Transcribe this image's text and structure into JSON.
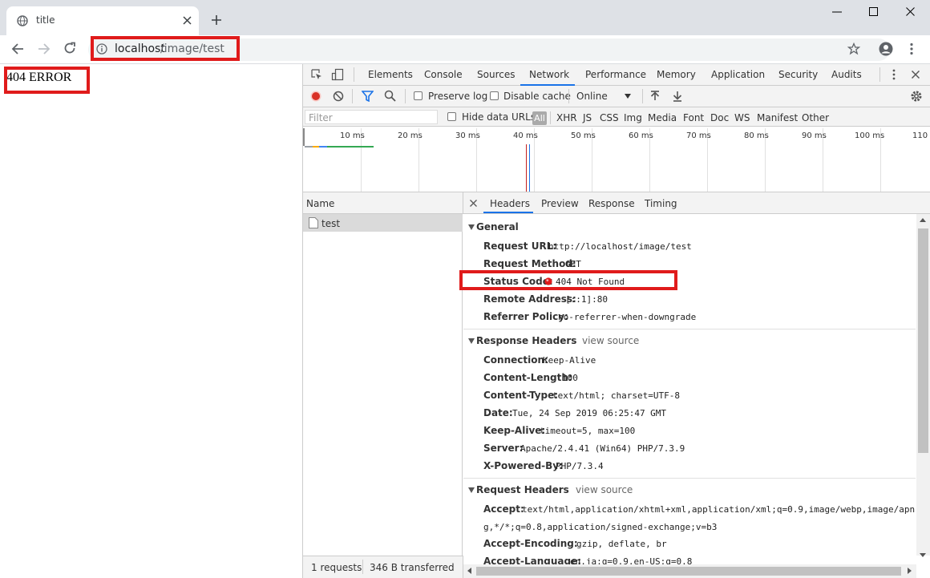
{
  "browser": {
    "tab_title": "title",
    "url_host": "localhost",
    "url_path": "/image/test"
  },
  "page": {
    "text": "404 ERROR"
  },
  "devtools": {
    "tabs": [
      "Elements",
      "Console",
      "Sources",
      "Network",
      "Performance",
      "Memory",
      "Application",
      "Security",
      "Audits"
    ],
    "active_tab": "Network",
    "toolbar": {
      "preserve_log": "Preserve log",
      "disable_cache": "Disable cache",
      "throttle": "Online"
    },
    "filter": {
      "placeholder": "Filter",
      "hide_data_urls": "Hide data URLs",
      "types": [
        "All",
        "XHR",
        "JS",
        "CSS",
        "Img",
        "Media",
        "Font",
        "Doc",
        "WS",
        "Manifest",
        "Other"
      ]
    },
    "timeline_ticks": [
      "10 ms",
      "20 ms",
      "30 ms",
      "40 ms",
      "50 ms",
      "60 ms",
      "70 ms",
      "80 ms",
      "90 ms",
      "100 ms",
      "110"
    ],
    "name_header": "Name",
    "requests": [
      {
        "name": "test"
      }
    ],
    "status_bar": {
      "requests": "1 requests",
      "transferred": "346 B transferred"
    },
    "detail_tabs": [
      "Headers",
      "Preview",
      "Response",
      "Timing"
    ],
    "general": {
      "title": "General",
      "rows": [
        {
          "key": "Request URL:",
          "value": "http://localhost/image/test"
        },
        {
          "key": "Request Method:",
          "value": "GET"
        },
        {
          "key": "Status Code:",
          "value": "404 Not Found"
        },
        {
          "key": "Remote Address:",
          "value": "[::1]:80"
        },
        {
          "key": "Referrer Policy:",
          "value": "no-referrer-when-downgrade"
        }
      ]
    },
    "response_headers": {
      "title": "Response Headers",
      "view_source": "view source",
      "rows": [
        {
          "key": "Connection:",
          "value": "Keep-Alive"
        },
        {
          "key": "Content-Length:",
          "value": "100"
        },
        {
          "key": "Content-Type:",
          "value": "text/html; charset=UTF-8"
        },
        {
          "key": "Date:",
          "value": "Tue, 24 Sep 2019 06:25:47 GMT"
        },
        {
          "key": "Keep-Alive:",
          "value": "timeout=5, max=100"
        },
        {
          "key": "Server:",
          "value": "Apache/2.4.41 (Win64) PHP/7.3.9"
        },
        {
          "key": "X-Powered-By:",
          "value": "PHP/7.3.4"
        }
      ]
    },
    "request_headers": {
      "title": "Request Headers",
      "view_source": "view source",
      "rows": [
        {
          "key": "Accept:",
          "value": "text/html,application/xhtml+xml,application/xml;q=0.9,image/webp,image/apn",
          "value_cont": "g,*/*;q=0.8,application/signed-exchange;v=b3"
        },
        {
          "key": "Accept-Encoding:",
          "value": "gzip, deflate, br"
        },
        {
          "key": "Accept-Language:",
          "value": "en,ja;q=0.9,en-US;q=0.8"
        }
      ]
    }
  },
  "colors": {
    "highlight": "#e01b1b",
    "status_error": "#e01b1b",
    "accent": "#1a73e8"
  }
}
